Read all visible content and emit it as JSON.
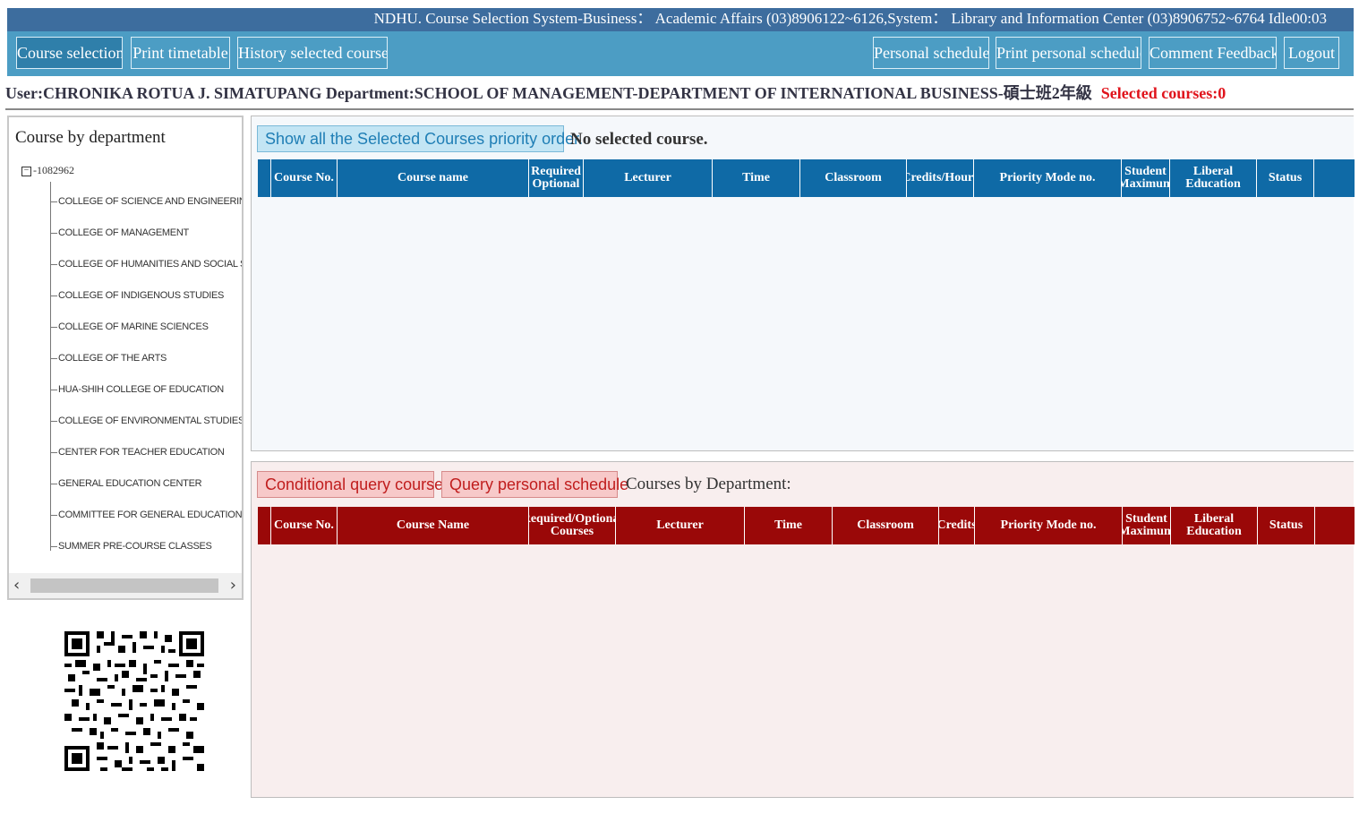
{
  "top_bar": {
    "text": "NDHU. Course Selection System-Business： Academic Affairs (03)8906122~6126,System： Library and Information Center (03)8906752~6764 Idle00:03"
  },
  "nav": {
    "left": [
      "Course selection",
      "Print timetable",
      "History selected courses"
    ],
    "right": [
      "Personal schedule",
      "Print personal schedule",
      "Comment Feedback",
      "Logout"
    ]
  },
  "user_bar": {
    "info": "User:CHRONIKA ROTUA J. SIMATUPANG Department:SCHOOL OF MANAGEMENT-DEPARTMENT OF INTERNATIONAL BUSINESS-碩士班2年級",
    "selected": "Selected courses:0"
  },
  "tree": {
    "title": "Course by department",
    "root": "1082962",
    "items": [
      "COLLEGE OF SCIENCE AND ENGINEERING",
      "COLLEGE OF MANAGEMENT",
      "COLLEGE OF HUMANITIES AND SOCIAL SCIEN",
      "COLLEGE OF INDIGENOUS STUDIES",
      "COLLEGE OF MARINE SCIENCES",
      "COLLEGE OF THE ARTS",
      "HUA-SHIH COLLEGE OF EDUCATION",
      "COLLEGE OF ENVIRONMENTAL STUDIES",
      "CENTER FOR TEACHER EDUCATION",
      "GENERAL EDUCATION CENTER",
      "COMMITTEE FOR GENERAL EDUCATION",
      "SUMMER PRE-COURSE CLASSES"
    ]
  },
  "selected_panel": {
    "button": "Show all the Selected Courses priority order.",
    "empty_text": "No selected course.",
    "columns": [
      "",
      "Course No.",
      "Course name",
      "Required Optional",
      "Lecturer",
      "Time",
      "Classroom",
      "Credits/Hours",
      "Priority Mode no.",
      "Student Maximum",
      "Liberal Education",
      "Status",
      ""
    ]
  },
  "query_panel": {
    "conditional_button": "Conditional query course",
    "personal_button": "Query personal schedule",
    "label": "Courses by Department:",
    "columns": [
      "",
      "Course No.",
      "Course Name",
      "Required/Optional Courses",
      "Lecturer",
      "Time",
      "Classroom",
      "Credits",
      "Priority Mode no.",
      "Student Maximum",
      "Liberal Education",
      "Status",
      ""
    ]
  },
  "colors": {
    "top_bar": "#3d6d9e",
    "nav_bar": "#4c9dc4",
    "selected_header": "#0f6aa6",
    "query_header": "#9a0808",
    "selected_count": "#e0141c"
  },
  "icons": {
    "tree_toggle": "minus-box-icon",
    "scroll_left": "chevron-left-icon",
    "scroll_right": "chevron-right-icon",
    "qr": "qr-code-icon"
  }
}
